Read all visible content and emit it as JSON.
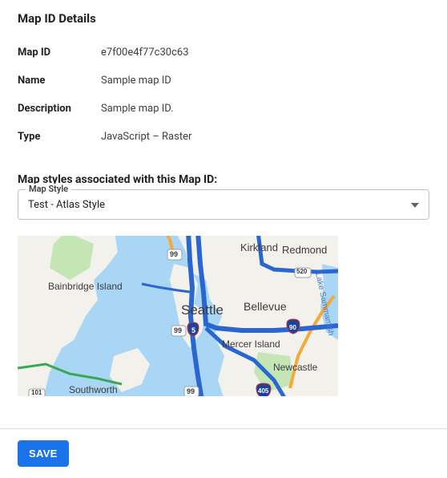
{
  "section_title": "Map ID Details",
  "details": {
    "map_id_label": "Map ID",
    "map_id_value": "e7f00e4f77c30c63",
    "name_label": "Name",
    "name_value": "Sample map ID",
    "description_label": "Description",
    "description_value": "Sample map ID.",
    "type_label": "Type",
    "type_value": "JavaScript – Raster"
  },
  "assoc_title": "Map styles associated with this Map ID:",
  "map_style": {
    "label": "Map Style",
    "selected": "Test - Atlas Style"
  },
  "map_places": {
    "seattle": "Seattle",
    "bellevue": "Bellevue",
    "kirkland": "Kirkland",
    "redmond": "Redmond",
    "mercer_island": "Mercer Island",
    "newcastle": "Newcastle",
    "bainbridge_island": "Bainbridge Island",
    "southworth": "Southworth",
    "sammamish": "Lake Sammamish",
    "shield_101": "101",
    "shield_5": "5",
    "shield_90": "90",
    "shield_99a": "99",
    "shield_99b": "99",
    "shield_99c": "99",
    "shield_520": "520",
    "shield_405": "405"
  },
  "footer": {
    "save_label": "SAVE"
  }
}
